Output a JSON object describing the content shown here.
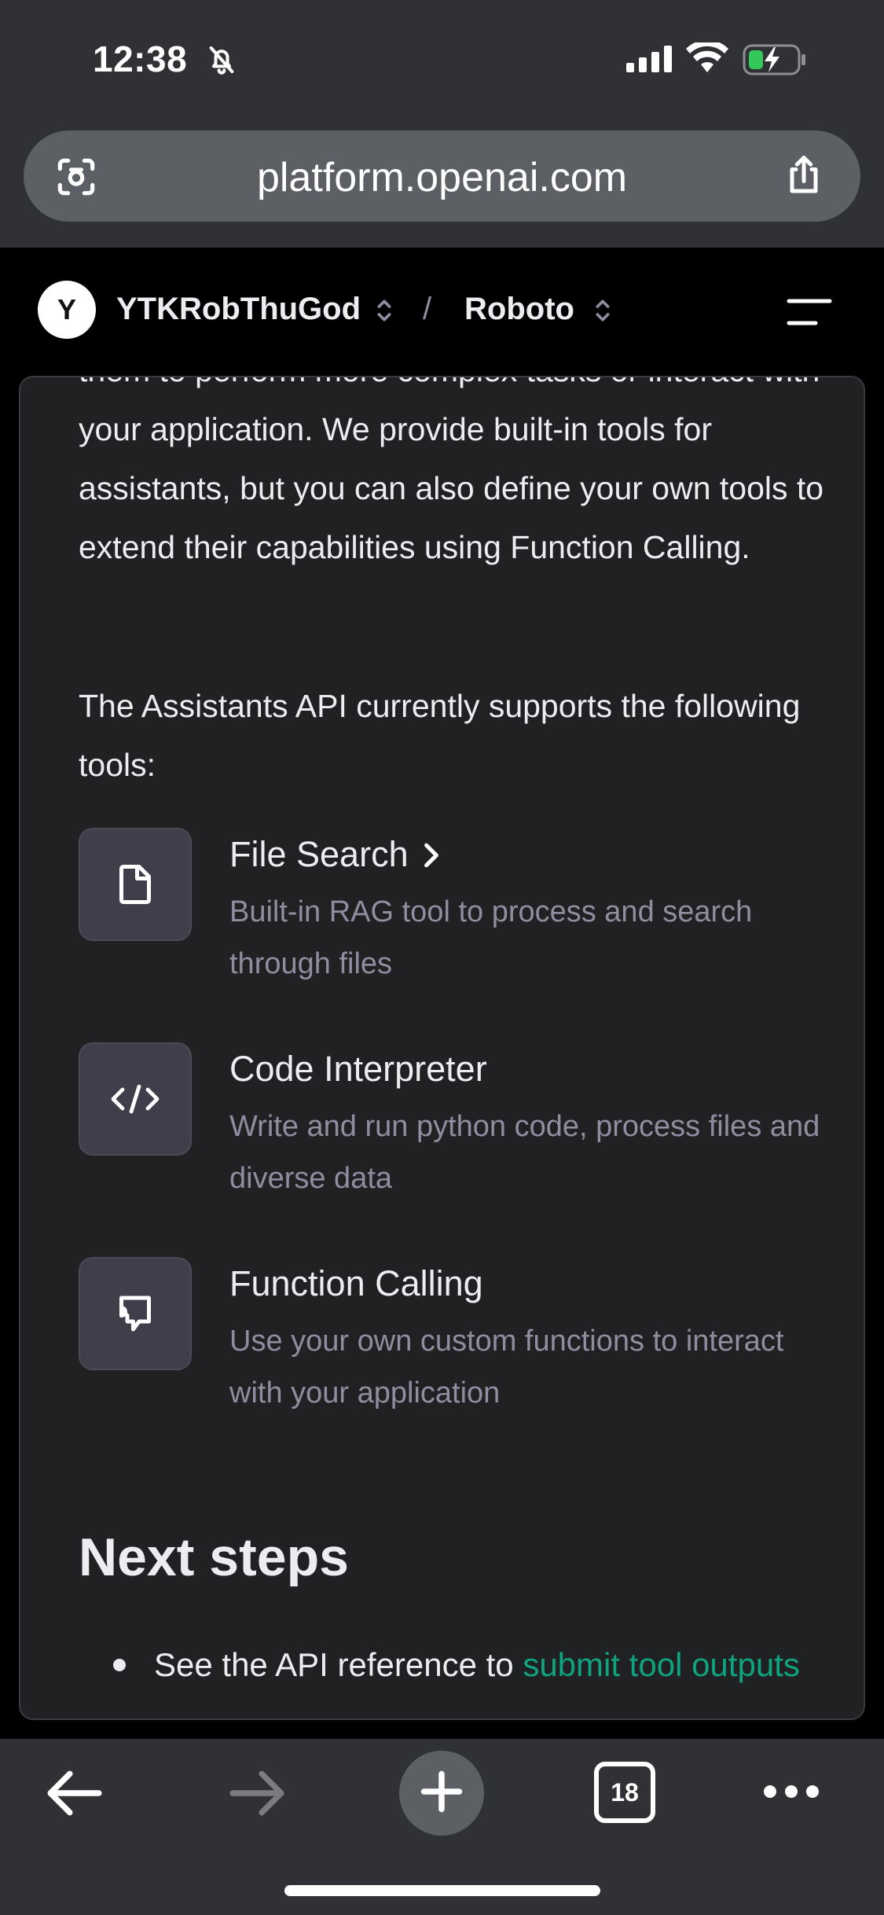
{
  "status_bar": {
    "time": "12:38",
    "icons": [
      "bell-slash-icon",
      "cellular-signal-icon",
      "wifi-icon",
      "battery-charging-icon"
    ]
  },
  "browser": {
    "url": "platform.openai.com",
    "icons": [
      "camera-scan-icon",
      "share-icon"
    ]
  },
  "header": {
    "avatar_letter": "Y",
    "org_name": "YTKRobThuGod",
    "separator": "/",
    "project_name": "Roboto",
    "icons": [
      "chevron-up-down-icon",
      "menu-icon"
    ]
  },
  "content": {
    "paragraph_1": "them to perform more complex tasks or interact with your application. We provide built-in tools for assistants, but you can also define your own tools to extend their capabilities using Function Calling.",
    "paragraph_2": "The Assistants API currently supports the following tools:",
    "tools": [
      {
        "title": "File Search",
        "description": "Built-in RAG tool to process and search through files",
        "icon": "file-icon"
      },
      {
        "title": "Code Interpreter",
        "description": "Write and run python code, process files and diverse data",
        "icon": "code-icon"
      },
      {
        "title": "Function Calling",
        "description": "Use your own custom functions to interact with your application",
        "icon": "function-icon"
      }
    ],
    "next_steps_heading": "Next steps",
    "next_steps_bullet_prefix": "See the API reference to ",
    "next_steps_bullet_link": "submit tool outputs"
  },
  "toolbar": {
    "tab_count": "18",
    "icons": [
      "back-arrow-icon",
      "forward-arrow-icon",
      "plus-icon",
      "tabs-icon",
      "more-icon"
    ]
  },
  "colors": {
    "background": "#000000",
    "chrome": "#303134",
    "card": "#202123",
    "text": "#ececf1",
    "muted_text": "#8e8ea0",
    "link": "#10a37f"
  }
}
